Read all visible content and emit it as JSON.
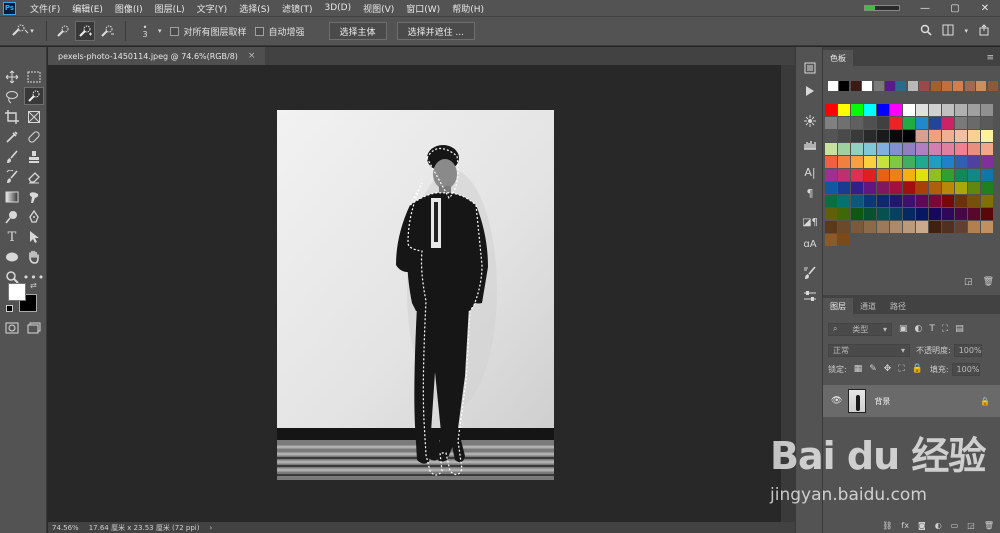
{
  "menubar": {
    "items": [
      "文件(F)",
      "编辑(E)",
      "图像(I)",
      "图层(L)",
      "文字(Y)",
      "选择(S)",
      "滤镜(T)",
      "3D(D)",
      "视图(V)",
      "窗口(W)",
      "帮助(H)"
    ],
    "logo": "Ps",
    "window_controls": [
      "—",
      "▢",
      "✕"
    ]
  },
  "options": {
    "brush_size": "3",
    "sample_all_layers": "对所有图层取样",
    "auto_enhance": "自动增强",
    "select_subject": "选择主体",
    "select_and_mask": "选择并遮住 ..."
  },
  "document": {
    "tab_title": "pexels-photo-1450114.jpeg @ 74.6%(RGB/8)",
    "close": "×"
  },
  "status": {
    "zoom": "74.56%",
    "info": "17.64 厘米 x 23.53 厘米 (72 ppi)",
    "arrow": "›"
  },
  "swatches_panel": {
    "tab": "色板",
    "row1": [
      "#ffffff",
      "#000000",
      "#3a1a14",
      "#ffffff",
      "#7a7a7a",
      "#5a1a8a",
      "#2a6a8a",
      "#b8b8b8",
      "#9a4a4a",
      "#a06030",
      "#c07040",
      "#d08050",
      "#a06a50",
      "#c89060",
      "#8a5a3a"
    ],
    "grid_colors": [
      [
        "#ff0000",
        "#ffff00",
        "#00ff00",
        "#00ffff",
        "#0000ff",
        "#ff00ff",
        "#ffffff",
        "#e0e0e0",
        "#d0d0d0",
        "#c0c0c0",
        "#b0b0b0",
        "#a0a0a0",
        "#909090"
      ],
      [
        "#808080",
        "#707070",
        "#606060",
        "#505050",
        "#404040",
        "#ee2222",
        "#22aa44",
        "#2288cc",
        "#224499",
        "#cc2266",
        "#7a7a7a",
        "#6a6a6a",
        "#5a5a5a"
      ],
      [
        "#555555",
        "#4a4a4a",
        "#3a3a3a",
        "#2a2a2a",
        "#1a1a1a",
        "#0a0a0a",
        "#000000",
        "#d8a090",
        "#f0a080",
        "#f0b090",
        "#f0c0a0",
        "#f8d090",
        "#fff0a0"
      ],
      [
        "#c8e0a0",
        "#a0d0a0",
        "#90d0c0",
        "#80c8d8",
        "#80b0e0",
        "#8090d0",
        "#9080c0",
        "#b080c0",
        "#d080b0",
        "#e080a0",
        "#f08090",
        "#e89080",
        "#f0a888"
      ],
      [
        "#f06040",
        "#f08040",
        "#f8a040",
        "#f8d040",
        "#c8e040",
        "#80c840",
        "#40b060",
        "#20a890",
        "#20a0c0",
        "#2080c8",
        "#3060b0",
        "#5040a0",
        "#803098"
      ],
      [
        "#a03090",
        "#c03070",
        "#e03050",
        "#e02020",
        "#e86010",
        "#f08010",
        "#f8b010",
        "#e0e010",
        "#90c020",
        "#30a030",
        "#108858",
        "#108888",
        "#1078a8"
      ],
      [
        "#1058a0",
        "#183c90",
        "#30208a",
        "#601880",
        "#801860",
        "#a01040",
        "#a01010",
        "#a84008",
        "#b06008",
        "#b88808",
        "#a8a808",
        "#608810",
        "#208020"
      ],
      [
        "#087040",
        "#087070",
        "#085880",
        "#083878",
        "#102870",
        "#201870",
        "#401070",
        "#600858",
        "#780838",
        "#780808",
        "#703008",
        "#785008",
        "#807008"
      ],
      [
        "#606008",
        "#406808",
        "#105810",
        "#085030",
        "#085050",
        "#084060",
        "#082860",
        "#081860",
        "#180858",
        "#300858",
        "#480848",
        "#580828",
        "#580808"
      ],
      [
        "#5a3a1a",
        "#6a4a2a",
        "#7a5a3a",
        "#8a6a4a",
        "#9a7a5a",
        "#aa8a6a",
        "#ba9a7a",
        "#caaa8a",
        "#402010",
        "#503020",
        "#604030",
        "#b08050",
        "#c09060"
      ],
      [
        "#8a5a2a",
        "#7a4a1a"
      ]
    ]
  },
  "layers_panel": {
    "tabs": [
      "图层",
      "通道",
      "路径"
    ],
    "filter_kind": "类型",
    "blend_mode": "正常",
    "opacity_label": "不透明度:",
    "opacity_value": "100%",
    "lock_label": "锁定:",
    "fill_label": "填充:",
    "fill_value": "100%",
    "layer_name": "背景"
  },
  "watermark": {
    "logo_text": "Bai du 经验",
    "url": "jingyan.baidu.com"
  }
}
